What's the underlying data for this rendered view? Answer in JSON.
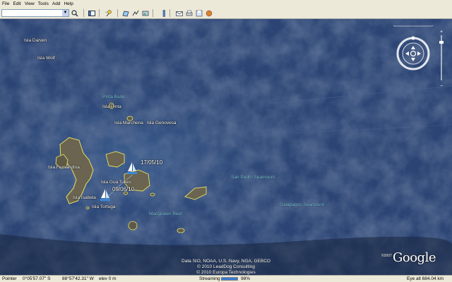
{
  "menu": [
    "File",
    "Edit",
    "View",
    "Tools",
    "Add",
    "Help"
  ],
  "search": {
    "value": "",
    "placeholder": ""
  },
  "map": {
    "islands": [
      {
        "name": "Isla Darwin"
      },
      {
        "name": "Isla Wolf"
      },
      {
        "name": "Isla Pinta"
      },
      {
        "name": "Isla Marchena"
      },
      {
        "name": "Isla Genovesa"
      },
      {
        "name": "Isla Fernandina"
      },
      {
        "name": "Isla Gua Tokes"
      },
      {
        "name": "Isla Isabela"
      },
      {
        "name": "Isla Tortuga"
      }
    ],
    "sea_features": [
      "Pinta Bank",
      "San Pedro Seamount",
      "Galapagos Seamount",
      "Macgowen Reef"
    ],
    "dates": [
      "17/05/10",
      "09/06/10"
    ],
    "credits": [
      "Data SIO, NOAA, U.S. Navy, NGA, GEBCO",
      "© 2010 LeadDog Consulting",
      "© 2010 Europa Technologies"
    ],
    "brand": "Google",
    "brand_year": "©2007"
  },
  "status": {
    "pointer_label": "Pointer",
    "lat": "0°05'57.07\" S",
    "lon": "88°57'42.31\" W",
    "elev": "elev    0 m",
    "streaming_label": "Streaming",
    "streaming_percent": "98%",
    "streaming_value": 0.98,
    "eye_alt": "Eye alt   684.04 km"
  },
  "colors": {
    "ocean": "#1c2d4a",
    "island_outline": "#e8e060",
    "chrome": "#ece9d8"
  }
}
